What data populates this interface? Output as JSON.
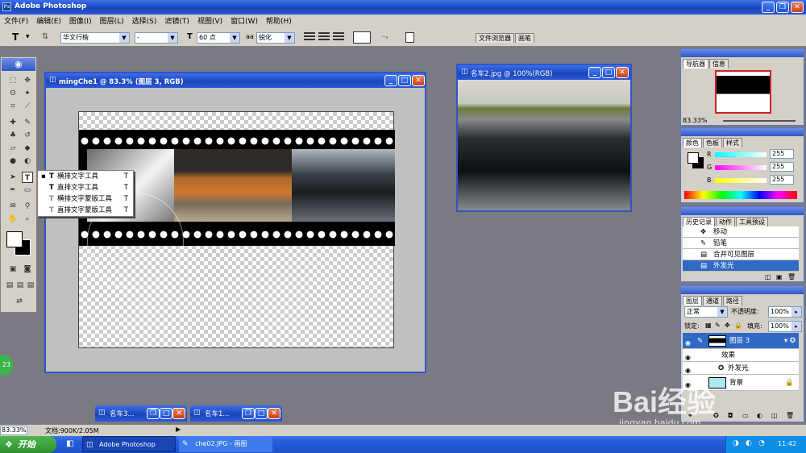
{
  "app": {
    "title": "Adobe Photoshop"
  },
  "menu": [
    "文件(F)",
    "编辑(E)",
    "图像(I)",
    "图层(L)",
    "选择(S)",
    "滤镜(T)",
    "视图(V)",
    "窗口(W)",
    "帮助(H)"
  ],
  "options": {
    "tool_glyph": "T",
    "font_family": "华文行楷",
    "font_style": "-",
    "font_size": "60 点",
    "aa_label": "aa",
    "antialias": "锐化",
    "palette_tabs": [
      "文件浏览器",
      "画笔"
    ]
  },
  "doc_main": {
    "title": "mingChe1 @ 83.3% (图层 3, RGB)"
  },
  "doc_car2": {
    "title": "名车2.jpg @ 100%(RGB)"
  },
  "minimized": [
    {
      "title": "名车3..."
    },
    {
      "title": "名车1..."
    }
  ],
  "tool_flyout": {
    "items": [
      {
        "label": "横排文字工具",
        "key": "T",
        "selected": true
      },
      {
        "label": "直排文字工具",
        "key": "T",
        "selected": false
      },
      {
        "label": "横排文字蒙版工具",
        "key": "T",
        "selected": false
      },
      {
        "label": "直排文字蒙版工具",
        "key": "T",
        "selected": false
      }
    ]
  },
  "navigator": {
    "tabs": [
      "导航器",
      "信息"
    ],
    "zoom": "83.33%"
  },
  "color_panel": {
    "tabs": [
      "颜色",
      "色板",
      "样式"
    ],
    "channels": [
      {
        "label": "R",
        "value": "255"
      },
      {
        "label": "G",
        "value": "255"
      },
      {
        "label": "B",
        "value": "255"
      }
    ]
  },
  "history": {
    "tabs": [
      "历史记录",
      "动作",
      "工具预设"
    ],
    "items": [
      "移动",
      "铅笔",
      "合并可见图层",
      "外发光"
    ],
    "selected_index": 3
  },
  "layers": {
    "tabs": [
      "图层",
      "通道",
      "路径"
    ],
    "blend_mode": "正常",
    "opacity_label": "不透明度:",
    "opacity": "100%",
    "lock_label": "锁定:",
    "fill_label": "填充:",
    "fill": "100%",
    "rows": [
      {
        "name": "图层 3",
        "selected": true
      },
      {
        "name": "效果",
        "selected": false
      },
      {
        "name": "外发光",
        "selected": false
      },
      {
        "name": "背景",
        "selected": false
      }
    ]
  },
  "status": {
    "zoom": "83.33%",
    "doc_info": "文档:900K/2.05M"
  },
  "taskbar": {
    "start": "开始",
    "tasks": [
      "Adobe Photoshop",
      "che02.JPG - 画图"
    ],
    "clock": "11:42"
  },
  "watermark": {
    "brand": "Bai经验",
    "url": "jingyan.baidu.com"
  },
  "left_badge": "23",
  "colors": {
    "titlebar": "#1f4ec4",
    "workspace": "#7a7a82",
    "panel": "#d4d0c8",
    "selection": "#316ac5",
    "taskbar": "#245edb",
    "start": "#3a9a3a"
  }
}
